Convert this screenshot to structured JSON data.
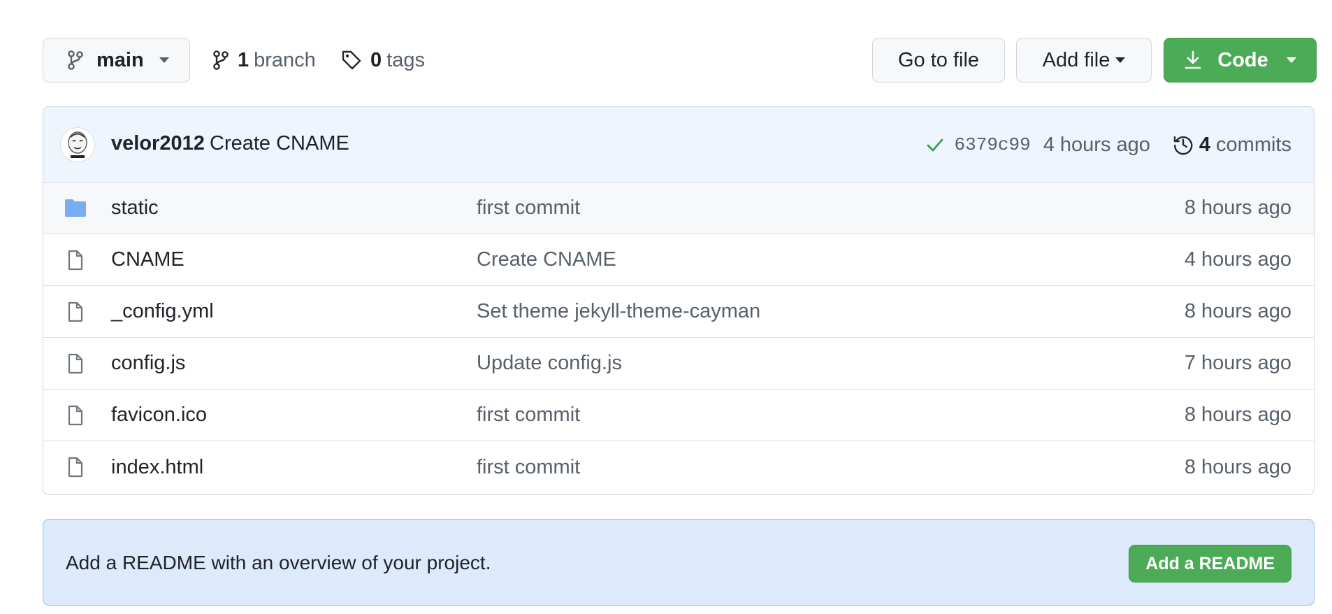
{
  "toolbar": {
    "branch_button": "main",
    "branches_count": "1",
    "branches_label": "branch",
    "tags_count": "0",
    "tags_label": "tags",
    "go_to_file": "Go to file",
    "add_file": "Add file",
    "code": "Code"
  },
  "latest_commit": {
    "author": "velor2012",
    "message": "Create CNAME",
    "sha": "6379c99",
    "time": "4 hours ago",
    "commits_count": "4",
    "commits_label": "commits"
  },
  "files": [
    {
      "name": "static",
      "type": "folder",
      "message": "first commit",
      "time": "8 hours ago"
    },
    {
      "name": "CNAME",
      "type": "file",
      "message": "Create CNAME",
      "time": "4 hours ago"
    },
    {
      "name": "_config.yml",
      "type": "file",
      "message": "Set theme jekyll-theme-cayman",
      "time": "8 hours ago"
    },
    {
      "name": "config.js",
      "type": "file",
      "message": "Update config.js",
      "time": "7 hours ago"
    },
    {
      "name": "favicon.ico",
      "type": "file",
      "message": "first commit",
      "time": "8 hours ago"
    },
    {
      "name": "index.html",
      "type": "file",
      "message": "first commit",
      "time": "8 hours ago"
    }
  ],
  "readme": {
    "text": "Add a README with an overview of your project.",
    "button": "Add a README"
  },
  "colors": {
    "primary_green": "#4cab56",
    "commit_header_bg": "#eef5fc",
    "readme_bg": "#ddeafb",
    "folder_blue": "#79adf1",
    "check_green": "#2da44e"
  },
  "icons": [
    "git-branch-icon",
    "tag-icon",
    "download-icon",
    "check-icon",
    "history-icon",
    "folder-icon",
    "file-icon"
  ]
}
